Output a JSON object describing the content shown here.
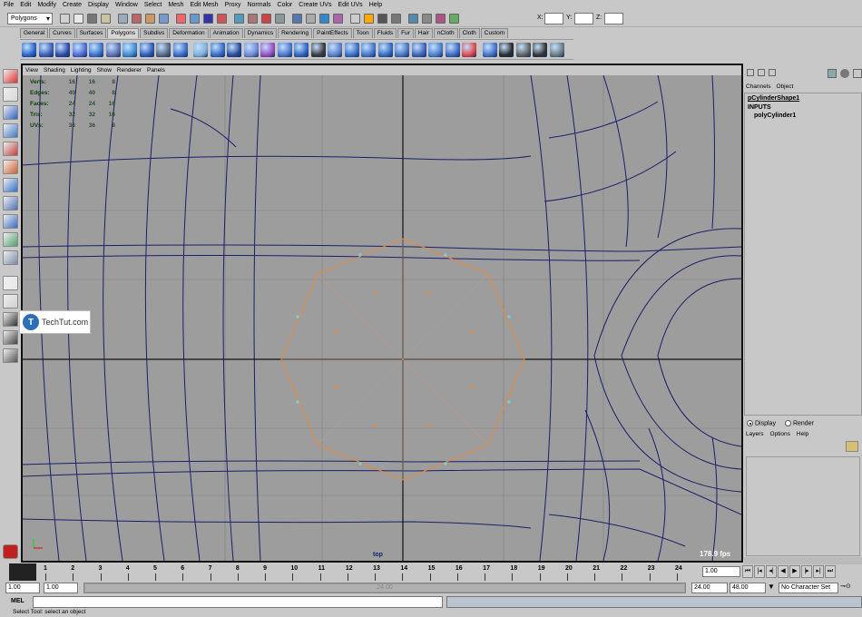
{
  "menu": [
    "File",
    "Edit",
    "Modify",
    "Create",
    "Display",
    "Window",
    "Select",
    "Mesh",
    "Edit Mesh",
    "Proxy",
    "Normals",
    "Color",
    "Create UVs",
    "Edit UVs",
    "Help"
  ],
  "status_line": {
    "mode": "Polygons",
    "x_label": "X:",
    "y_label": "Y:",
    "z_label": "Z:"
  },
  "shelf_tabs": [
    "General",
    "Curves",
    "Surfaces",
    "Polygons",
    "Subdivs",
    "Deformation",
    "Animation",
    "Dynamics",
    "Rendering",
    "PaintEffects",
    "Toon",
    "Fluids",
    "Fur",
    "Hair",
    "nCloth",
    "Cloth",
    "Custom"
  ],
  "active_shelf": "Polygons",
  "viewport": {
    "menu": [
      "View",
      "Shading",
      "Lighting",
      "Show",
      "Renderer",
      "Panels"
    ],
    "hud": [
      {
        "label": "Verts:",
        "v": [
          "16",
          "16",
          "8"
        ]
      },
      {
        "label": "Edges:",
        "v": [
          "40",
          "40",
          "8"
        ]
      },
      {
        "label": "Faces:",
        "v": [
          "24",
          "24",
          "16"
        ]
      },
      {
        "label": "Tris:",
        "v": [
          "32",
          "32",
          "16"
        ]
      },
      {
        "label": "UVs:",
        "v": [
          "36",
          "36",
          "8"
        ]
      }
    ],
    "camera": "top",
    "fps": "178.9 fps",
    "bg_color": "#9d9d9d",
    "wire_color": "#1b1f6a",
    "selection_color": "#e58a3a"
  },
  "watermark": {
    "letter": "T",
    "text": "TechTut.com"
  },
  "channel_box": {
    "tabs": [
      "Channels",
      "Object"
    ],
    "node": "pCylinderShape1",
    "inputs_label": "INPUTS",
    "input_node": "polyCylinder1"
  },
  "layer_editor": {
    "display_label": "Display",
    "render_label": "Render",
    "menu": [
      "Layers",
      "Options",
      "Help"
    ]
  },
  "time_slider": {
    "ticks": [
      "1",
      "2",
      "3",
      "4",
      "5",
      "6",
      "7",
      "8",
      "9",
      "10",
      "11",
      "12",
      "13",
      "14",
      "15",
      "16",
      "17",
      "18",
      "19",
      "20",
      "21",
      "22",
      "23",
      "24"
    ],
    "current_frame": "1.00"
  },
  "range_slider": {
    "start": "1.00",
    "anim_start": "1.00",
    "range_label": "24.00",
    "end": "24.00",
    "anim_end": "48.00",
    "character_set": "No Character Set"
  },
  "command_line": {
    "label": "MEL"
  },
  "help_line": "Select Tool: select an object"
}
